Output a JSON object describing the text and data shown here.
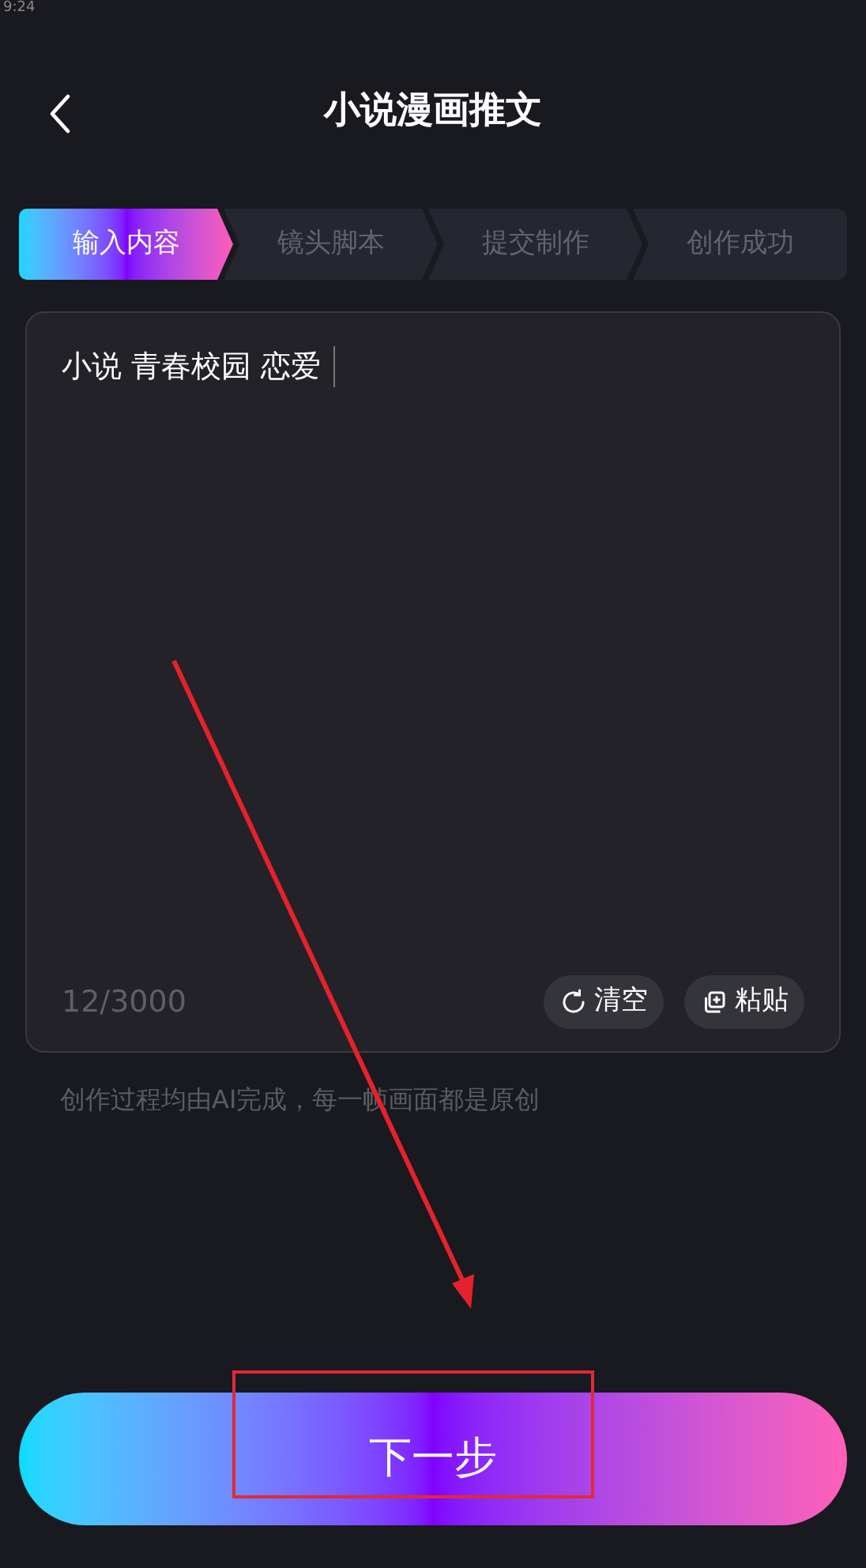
{
  "status_bar": {
    "time": "9:24"
  },
  "header": {
    "title": "小说漫画推文"
  },
  "steps": [
    {
      "label": "输入内容",
      "selected": true
    },
    {
      "label": "镜头脚本",
      "selected": false
    },
    {
      "label": "提交制作",
      "selected": false
    },
    {
      "label": "创作成功",
      "selected": false
    }
  ],
  "editor": {
    "value": "小说 青春校园 恋爱",
    "count": "12/3000",
    "buttons": [
      {
        "kind": "clear",
        "label": "清空"
      },
      {
        "kind": "paste",
        "label": "粘贴"
      }
    ]
  },
  "hint": "创作过程均由AI完成，每一帧画面都是原创",
  "next_button": {
    "label": "下一步"
  }
}
